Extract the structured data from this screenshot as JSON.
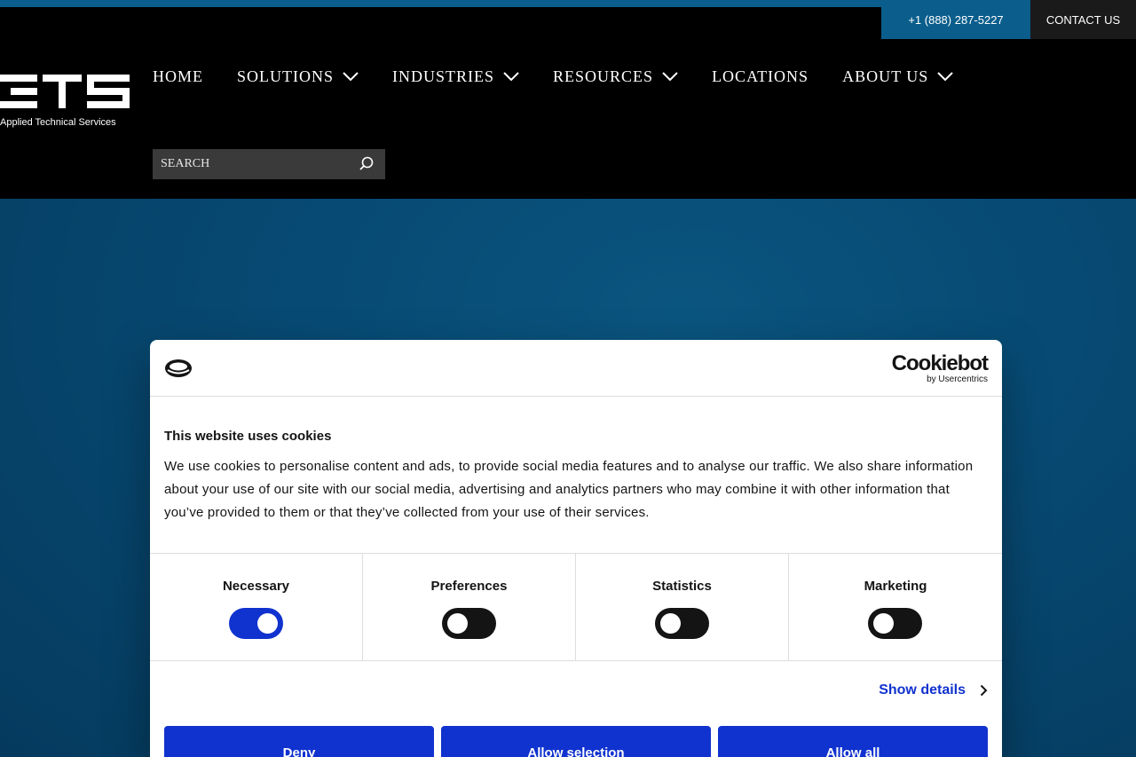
{
  "topbar": {
    "phone": "+1 (888) 287-5227",
    "contact": "CONTACT US"
  },
  "brand": {
    "logo_text": "Applied Technical Services"
  },
  "nav": {
    "items": [
      {
        "label": "HOME",
        "has_menu": false
      },
      {
        "label": "SOLUTIONS",
        "has_menu": true
      },
      {
        "label": "INDUSTRIES",
        "has_menu": true
      },
      {
        "label": "RESOURCES",
        "has_menu": true
      },
      {
        "label": "LOCATIONS",
        "has_menu": false
      },
      {
        "label": "ABOUT US",
        "has_menu": true
      }
    ]
  },
  "search": {
    "placeholder": "SEARCH"
  },
  "cookie_dialog": {
    "brand_name": "Cookiebot",
    "brand_sub": "by Usercentrics",
    "title": "This website uses cookies",
    "body": "We use cookies to personalise content and ads, to provide social media features and to analyse our traffic. We also share information about your use of our site with our social media, advertising and analytics partners who may combine it with other information that you’ve provided to them or that they’ve collected from your use of their services.",
    "toggles": [
      {
        "label": "Necessary",
        "on": true
      },
      {
        "label": "Preferences",
        "on": false
      },
      {
        "label": "Statistics",
        "on": false
      },
      {
        "label": "Marketing",
        "on": false
      }
    ],
    "show_details": "Show details",
    "buttons": {
      "deny": "Deny",
      "allow_selection": "Allow selection",
      "allow_all": "Allow all"
    }
  },
  "colors": {
    "accent_blue": "#0b5e8c",
    "cookiebot_blue": "#1032cf",
    "hero_blue": "#074a73"
  }
}
